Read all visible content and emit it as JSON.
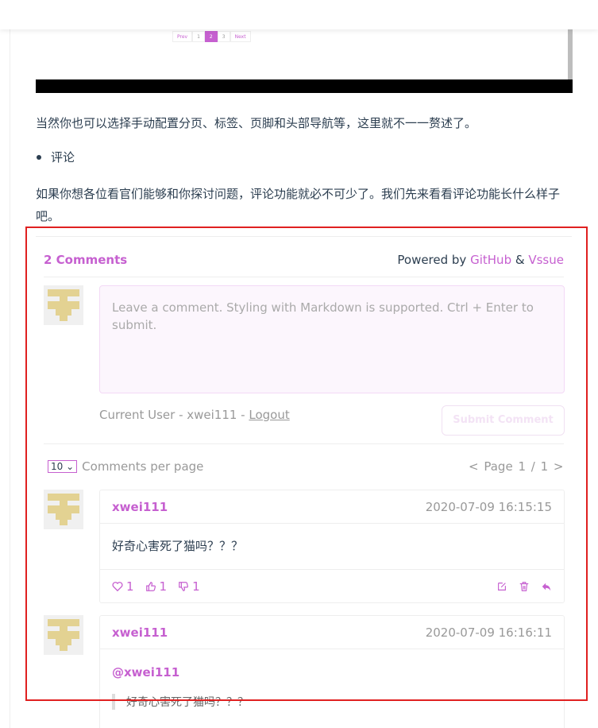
{
  "pager": {
    "prev": "Prev",
    "pages": [
      "1",
      "2",
      "3"
    ],
    "active": "2",
    "next": "Next"
  },
  "article": {
    "p1": "当然你也可以选择手动配置分页、标签、页脚和头部导航等，这里就不一一赘述了。",
    "list_item": "评论",
    "p2": "如果你想各位看官们能够和你探讨问题，评论功能就必不可少了。我们先来看看评论功能长什么样子吧。"
  },
  "vssue": {
    "count_label": "2 Comments",
    "powered_prefix": "Powered by",
    "github": "GitHub",
    "amp": "&",
    "vssue": "Vssue",
    "placeholder": "Leave a comment. Styling with Markdown is supported. Ctrl + Enter to submit.",
    "current_user_prefix": "Current User - xwei111 -",
    "logout": "Logout",
    "submit": "Submit Comment",
    "per_page_value": "10",
    "per_page_label": "Comments per page",
    "page_prev": "<",
    "page_text": "Page 1 / 1",
    "page_next": ">",
    "comments": [
      {
        "author": "xwei111",
        "time": "2020-07-09 16:15:15",
        "body": "好奇心害死了猫吗？？？",
        "hearts": "1",
        "likes": "1",
        "dislikes": "1"
      },
      {
        "author": "xwei111",
        "time": "2020-07-09 16:16:11",
        "mention": "@xwei111",
        "quote": "好奇心害死了猫吗？？？"
      }
    ]
  },
  "colors": {
    "accent": "#c660d0",
    "highlight_box": "#e02020",
    "avatar": "#e3d292"
  }
}
